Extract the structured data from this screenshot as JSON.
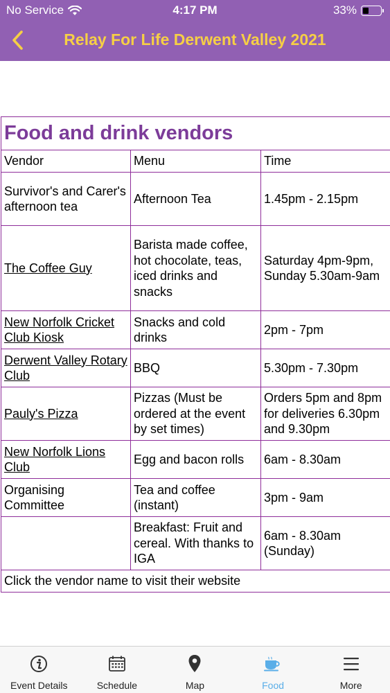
{
  "status_bar": {
    "carrier": "No Service",
    "time": "4:17 PM",
    "battery": "33%",
    "battery_level": 0.33
  },
  "nav": {
    "back_icon": "chevron-left-icon",
    "title": "Relay For Life Derwent Valley 2021"
  },
  "colors": {
    "header_bg": "#9160b3",
    "title_color": "#f6cf45",
    "table_border": "#8e2d9a",
    "heading_color": "#7c3c99",
    "active_tab": "#5aaee8"
  },
  "table": {
    "caption": "Food and drink vendors",
    "headers": [
      "Vendor",
      "Menu",
      "Time"
    ],
    "rows": [
      {
        "vendor": "Survivor's and Carer's afternoon tea",
        "link": false,
        "menu": "Afternoon Tea",
        "time": "1.45pm - 2.15pm"
      },
      {
        "vendor": "The Coffee Guy",
        "link": true,
        "menu": "Barista made coffee, hot chocolate, teas, iced drinks and snacks",
        "time": "Saturday 4pm-9pm, Sunday 5.30am-9am"
      },
      {
        "vendor": "New Norfolk Cricket Club Kiosk",
        "link": true,
        "menu": "Snacks and cold drinks",
        "time": "2pm - 7pm"
      },
      {
        "vendor": "Derwent Valley Rotary Club",
        "link": true,
        "menu": "BBQ",
        "time": "5.30pm - 7.30pm"
      },
      {
        "vendor": "Pauly's Pizza",
        "link": true,
        "menu": "Pizzas (Must be ordered at the event by set times)",
        "time": "Orders 5pm and 8pm for deliveries 6.30pm and 9.30pm"
      },
      {
        "vendor": "New Norfolk Lions Club",
        "link": true,
        "menu": "Egg and bacon rolls",
        "time": "6am - 8.30am"
      },
      {
        "vendor": "Organising Committee",
        "link": false,
        "menu": "Tea and coffee (instant)",
        "time": "3pm - 9am"
      },
      {
        "vendor": "",
        "link": false,
        "menu": "Breakfast: Fruit and cereal. With thanks to IGA",
        "time": "6am - 8.30am (Sunday)"
      }
    ],
    "footer_note": "Click the vendor name to visit their website"
  },
  "tabs": [
    {
      "label": "Event Details",
      "icon": "info-icon",
      "active": false
    },
    {
      "label": "Schedule",
      "icon": "calendar-icon",
      "active": false
    },
    {
      "label": "Map",
      "icon": "map-pin-icon",
      "active": false
    },
    {
      "label": "Food",
      "icon": "coffee-cup-icon",
      "active": true
    },
    {
      "label": "More",
      "icon": "menu-icon",
      "active": false
    }
  ]
}
